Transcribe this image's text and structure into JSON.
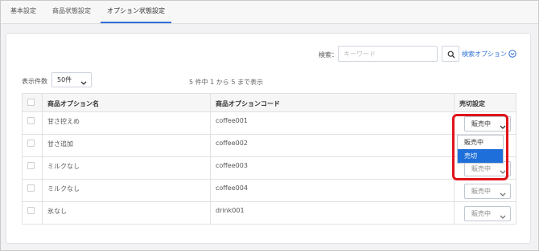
{
  "tabs": [
    {
      "label": "基本設定",
      "active": false
    },
    {
      "label": "商品状態設定",
      "active": false
    },
    {
      "label": "オプション状態設定",
      "active": true
    }
  ],
  "search": {
    "label": "検索：",
    "placeholder": "キーワード",
    "option_link": "検索オプション"
  },
  "list_controls": {
    "count_label": "表示件数",
    "count_value": "50件",
    "range_text": "5 件中 1 から 5 まで表示"
  },
  "table": {
    "headers": [
      "商品オプション名",
      "商品オプションコード",
      "売切設定"
    ],
    "rows": [
      {
        "name": "甘さ控えめ",
        "code": "coffee001",
        "status": "販売中"
      },
      {
        "name": "甘さ追加",
        "code": "coffee002",
        "status": "販売中"
      },
      {
        "name": "ミルクなし",
        "code": "coffee003",
        "status": "販売中"
      },
      {
        "name": "ミルクなし",
        "code": "coffee004",
        "status": "販売中"
      },
      {
        "name": "氷なし",
        "code": "drink001",
        "status": "販売中"
      }
    ]
  },
  "dropdown": {
    "options": [
      "販売中",
      "売切"
    ],
    "highlighted_index": 1
  },
  "colors": {
    "accent": "#2f6fd6",
    "selected_option_bg": "#1e6fd9",
    "callout_border": "#e0141a"
  }
}
